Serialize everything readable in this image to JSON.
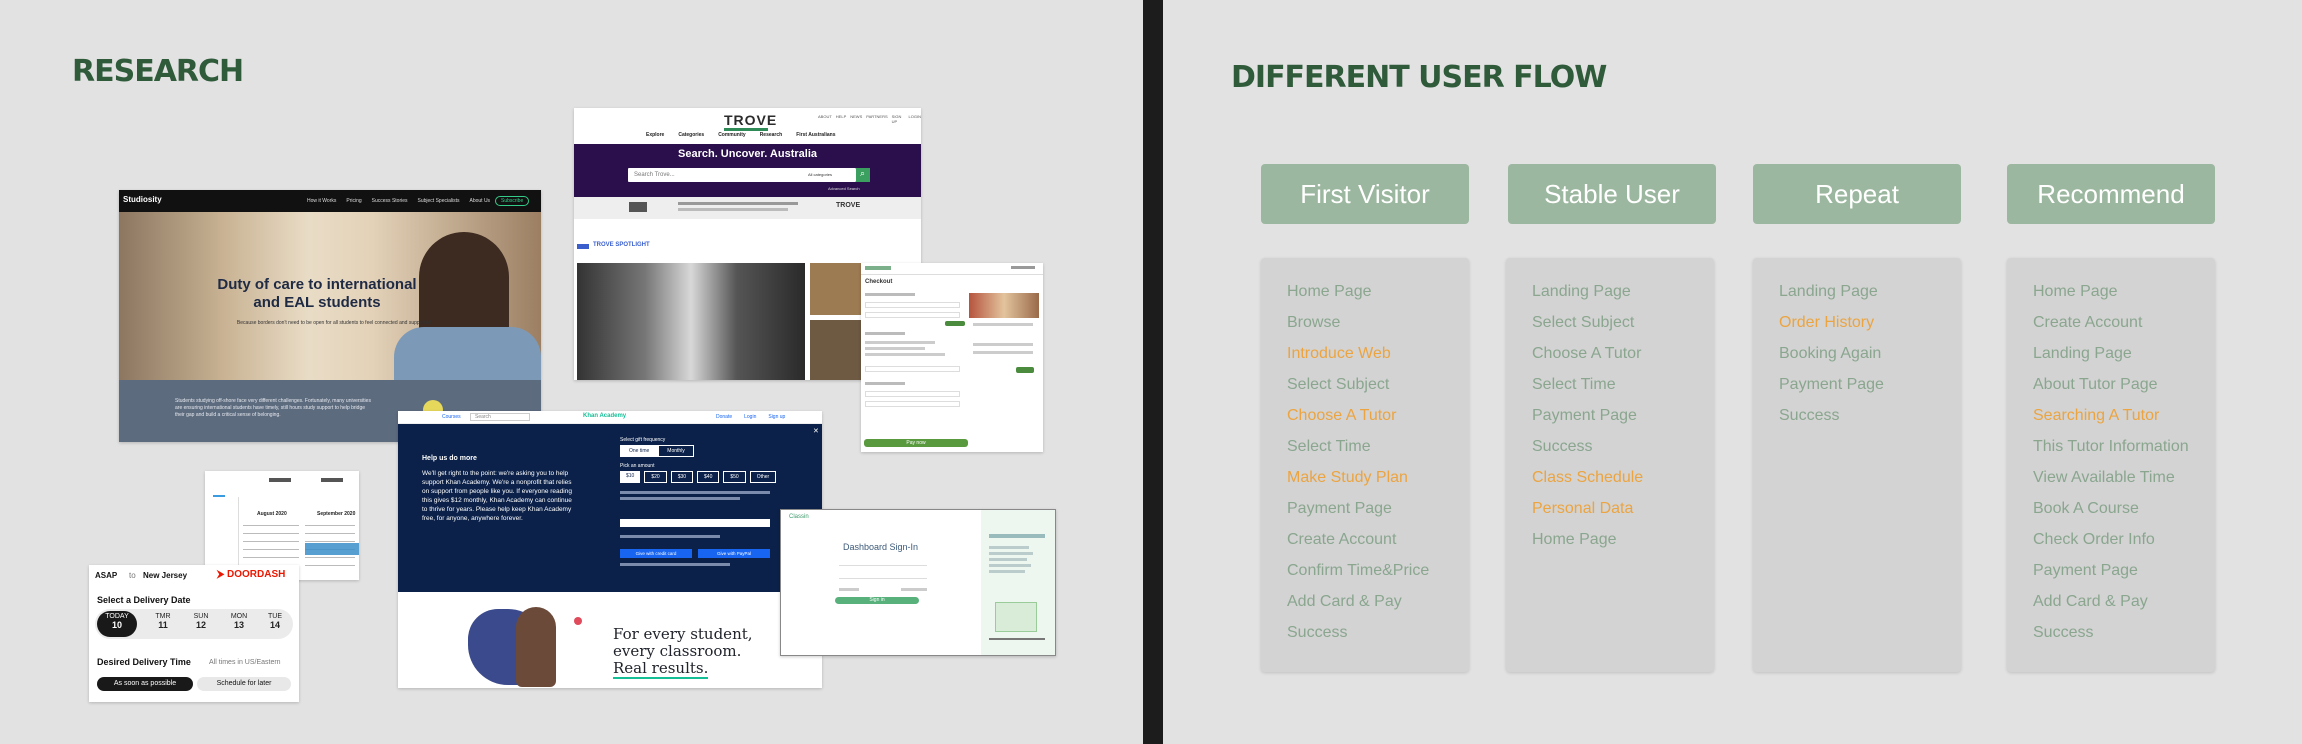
{
  "left": {
    "title": "RESEARCH",
    "studiosity": {
      "logo": "Studiosity",
      "nav": [
        "How it Works",
        "Pricing",
        "Success Stories",
        "Subject Specialists",
        "About Us"
      ],
      "nav_cta": "Subscribe",
      "headline_1": "Duty of care to international",
      "headline_2": "and EAL students",
      "sub": "Because borders don't need to be open for all students to feel connected and supported",
      "footer_text": "Students studying off-shore face very different challenges. Fortunately, many universities are ensuring international students have timely, still hours study support to help bridge their gap and build a critical sense of belonging."
    },
    "trove": {
      "logo": "TROVE",
      "top_links": [
        "ABOUT",
        "HELP",
        "NEWS",
        "PARTNERS",
        "SIGN UP",
        "LOGIN"
      ],
      "nav": [
        "Explore",
        "Categories",
        "Community",
        "Research",
        "First Australians"
      ],
      "hero": "Search. Uncover. Australia",
      "search_placeholder": "Search Trove...",
      "search_filter": "All categories",
      "advanced": "Advanced Search",
      "spotlight": "TROVE SPOTLIGHT"
    },
    "booking": {
      "heading": "Checkout",
      "confirm": "Pay now"
    },
    "khan": {
      "course_btn": "Courses",
      "search": "Search",
      "logo": "Khan Academy",
      "links": [
        "Donate",
        "Login",
        "Sign up"
      ],
      "modal_title": "Help us do more",
      "modal_body": "We'll get right to the point: we're asking you to help support Khan Academy. We're a nonprofit that relies on support from people like you. If everyone reading this gives $12 monthly, Khan Academy can continue to thrive for years. Please help keep Khan Academy free, for anyone, anywhere forever.",
      "freq_label": "Select gift frequency",
      "freq": [
        "One time",
        "Monthly"
      ],
      "amount_label": "Pick an amount",
      "amounts": [
        "$10",
        "$20",
        "$30",
        "$40",
        "$50",
        "Other"
      ],
      "card_btn": "Give with credit card",
      "paypal_btn": "Give with PayPal",
      "tagline_1": "For every student,",
      "tagline_2": "every classroom.",
      "tagline_3": "Real results."
    },
    "dashboard": {
      "brand": "Classin",
      "title": "Dashboard Sign-In",
      "button": "Sign in"
    },
    "calendar": {
      "months": [
        "August 2020",
        "September 2020"
      ]
    },
    "doordash": {
      "asap": "ASAP",
      "to": "to",
      "location": "New Jersey",
      "logo": "DOORDASH",
      "delivery_date": "Select a Delivery Date",
      "days": [
        {
          "d": "TODAY",
          "n": "10"
        },
        {
          "d": "TMR",
          "n": "11"
        },
        {
          "d": "SUN",
          "n": "12"
        },
        {
          "d": "MON",
          "n": "13"
        },
        {
          "d": "TUE",
          "n": "14"
        }
      ],
      "time_label": "Desired Delivery Time",
      "time_zone": "All times in US/Eastern",
      "asap_btn": "As soon as possible",
      "later_btn": "Schedule for later"
    }
  },
  "right": {
    "title": "DIFFERENT USER FLOW",
    "columns": [
      {
        "header": "First Visitor",
        "steps": [
          {
            "t": "Home Page",
            "h": false
          },
          {
            "t": "Browse",
            "h": false
          },
          {
            "t": "Introduce Web",
            "h": true
          },
          {
            "t": "Select Subject",
            "h": false
          },
          {
            "t": "Choose A Tutor",
            "h": true
          },
          {
            "t": "Select Time",
            "h": false
          },
          {
            "t": "Make Study Plan",
            "h": true
          },
          {
            "t": "Payment Page",
            "h": false
          },
          {
            "t": "Create Account",
            "h": false
          },
          {
            "t": "Confirm Time&Price",
            "h": false
          },
          {
            "t": "Add Card & Pay",
            "h": false
          },
          {
            "t": "Success",
            "h": false
          }
        ]
      },
      {
        "header": "Stable User",
        "steps": [
          {
            "t": "Landing Page",
            "h": false
          },
          {
            "t": "Select Subject",
            "h": false
          },
          {
            "t": "Choose A Tutor",
            "h": false
          },
          {
            "t": "Select Time",
            "h": false
          },
          {
            "t": "Payment Page",
            "h": false
          },
          {
            "t": "Success",
            "h": false
          },
          {
            "t": "Class Schedule",
            "h": true
          },
          {
            "t": "Personal Data",
            "h": true
          },
          {
            "t": "Home Page",
            "h": false
          }
        ]
      },
      {
        "header": "Repeat",
        "steps": [
          {
            "t": "Landing Page",
            "h": false
          },
          {
            "t": "Order History",
            "h": true
          },
          {
            "t": "Booking Again",
            "h": false
          },
          {
            "t": "Payment Page",
            "h": false
          },
          {
            "t": "Success",
            "h": false
          }
        ]
      },
      {
        "header": "Recommend",
        "steps": [
          {
            "t": "Home Page",
            "h": false
          },
          {
            "t": "Create Account",
            "h": false
          },
          {
            "t": "Landing Page",
            "h": false
          },
          {
            "t": "About Tutor Page",
            "h": false
          },
          {
            "t": "Searching A Tutor",
            "h": true
          },
          {
            "t": "This Tutor Information",
            "h": false
          },
          {
            "t": "View Available Time",
            "h": false
          },
          {
            "t": "Book A Course",
            "h": false
          },
          {
            "t": "Check Order Info",
            "h": false
          },
          {
            "t": "Payment Page",
            "h": false
          },
          {
            "t": "Add Card & Pay",
            "h": false
          },
          {
            "t": "Success",
            "h": false
          }
        ]
      }
    ]
  }
}
